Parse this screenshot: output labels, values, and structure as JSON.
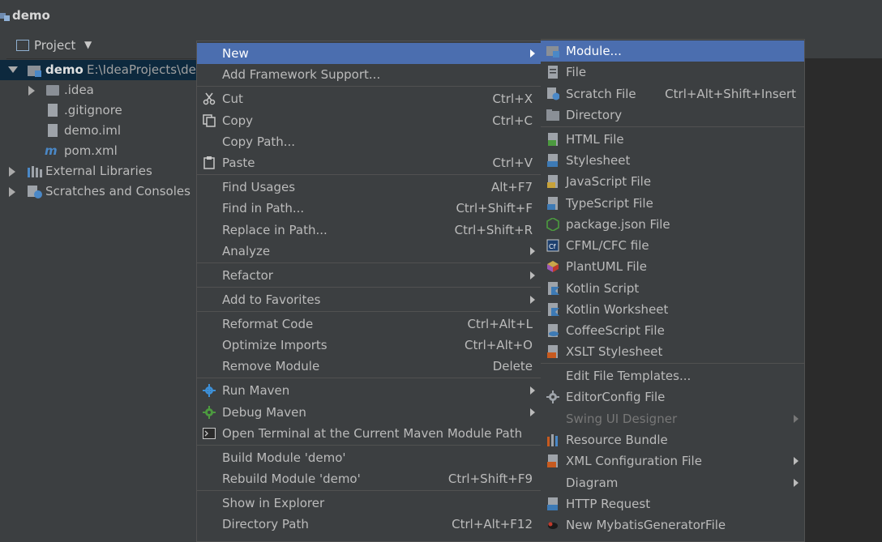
{
  "window": {
    "title": "demo"
  },
  "panel": {
    "title": "Project",
    "tree": [
      {
        "name": "demo",
        "path": "E:\\IdeaProjects\\de"
      },
      {
        "name": ".idea"
      },
      {
        "name": ".gitignore"
      },
      {
        "name": "demo.iml"
      },
      {
        "name": "pom.xml"
      },
      {
        "name": "External Libraries"
      },
      {
        "name": "Scratches and Consoles"
      }
    ]
  },
  "context_menu": {
    "items": [
      {
        "label": "New"
      },
      {
        "label": "Add Framework Support..."
      },
      {
        "label": "Cut",
        "shortcut": "Ctrl+X"
      },
      {
        "label": "Copy",
        "shortcut": "Ctrl+C"
      },
      {
        "label": "Copy Path..."
      },
      {
        "label": "Paste",
        "shortcut": "Ctrl+V"
      },
      {
        "label": "Find Usages",
        "shortcut": "Alt+F7"
      },
      {
        "label": "Find in Path...",
        "shortcut": "Ctrl+Shift+F"
      },
      {
        "label": "Replace in Path...",
        "shortcut": "Ctrl+Shift+R"
      },
      {
        "label": "Analyze"
      },
      {
        "label": "Refactor"
      },
      {
        "label": "Add to Favorites"
      },
      {
        "label": "Reformat Code",
        "shortcut": "Ctrl+Alt+L"
      },
      {
        "label": "Optimize Imports",
        "shortcut": "Ctrl+Alt+O"
      },
      {
        "label": "Remove Module",
        "shortcut": "Delete"
      },
      {
        "label": "Run Maven"
      },
      {
        "label": "Debug Maven"
      },
      {
        "label": "Open Terminal at the Current Maven Module Path"
      },
      {
        "label": "Build Module 'demo'"
      },
      {
        "label": "Rebuild Module 'demo'",
        "shortcut": "Ctrl+Shift+F9"
      },
      {
        "label": "Show in Explorer"
      },
      {
        "label": "Directory Path",
        "shortcut": "Ctrl+Alt+F12"
      }
    ]
  },
  "submenu_new": {
    "items": [
      {
        "label": "Module..."
      },
      {
        "label": "File"
      },
      {
        "label": "Scratch File",
        "shortcut": "Ctrl+Alt+Shift+Insert"
      },
      {
        "label": "Directory"
      },
      {
        "label": "HTML File"
      },
      {
        "label": "Stylesheet"
      },
      {
        "label": "JavaScript File"
      },
      {
        "label": "TypeScript File"
      },
      {
        "label": "package.json File"
      },
      {
        "label": "CFML/CFC file"
      },
      {
        "label": "PlantUML File"
      },
      {
        "label": "Kotlin Script"
      },
      {
        "label": "Kotlin Worksheet"
      },
      {
        "label": "CoffeeScript File"
      },
      {
        "label": "XSLT Stylesheet"
      },
      {
        "label": "Edit File Templates..."
      },
      {
        "label": "EditorConfig File"
      },
      {
        "label": "Swing UI Designer"
      },
      {
        "label": "Resource Bundle"
      },
      {
        "label": "XML Configuration File"
      },
      {
        "label": "Diagram"
      },
      {
        "label": "HTTP Request"
      },
      {
        "label": "New MybatisGeneratorFile"
      }
    ]
  },
  "icons": {
    "cut": "scissors-icon",
    "copy": "copy-icon",
    "paste": "clipboard-icon",
    "run_maven": "gear-icon",
    "debug_maven": "bug-gear-icon",
    "terminal": "terminal-icon"
  },
  "colors": {
    "highlight": "#4b6eaf",
    "menu_bg": "#3c3f41",
    "selection": "#0d293e"
  }
}
